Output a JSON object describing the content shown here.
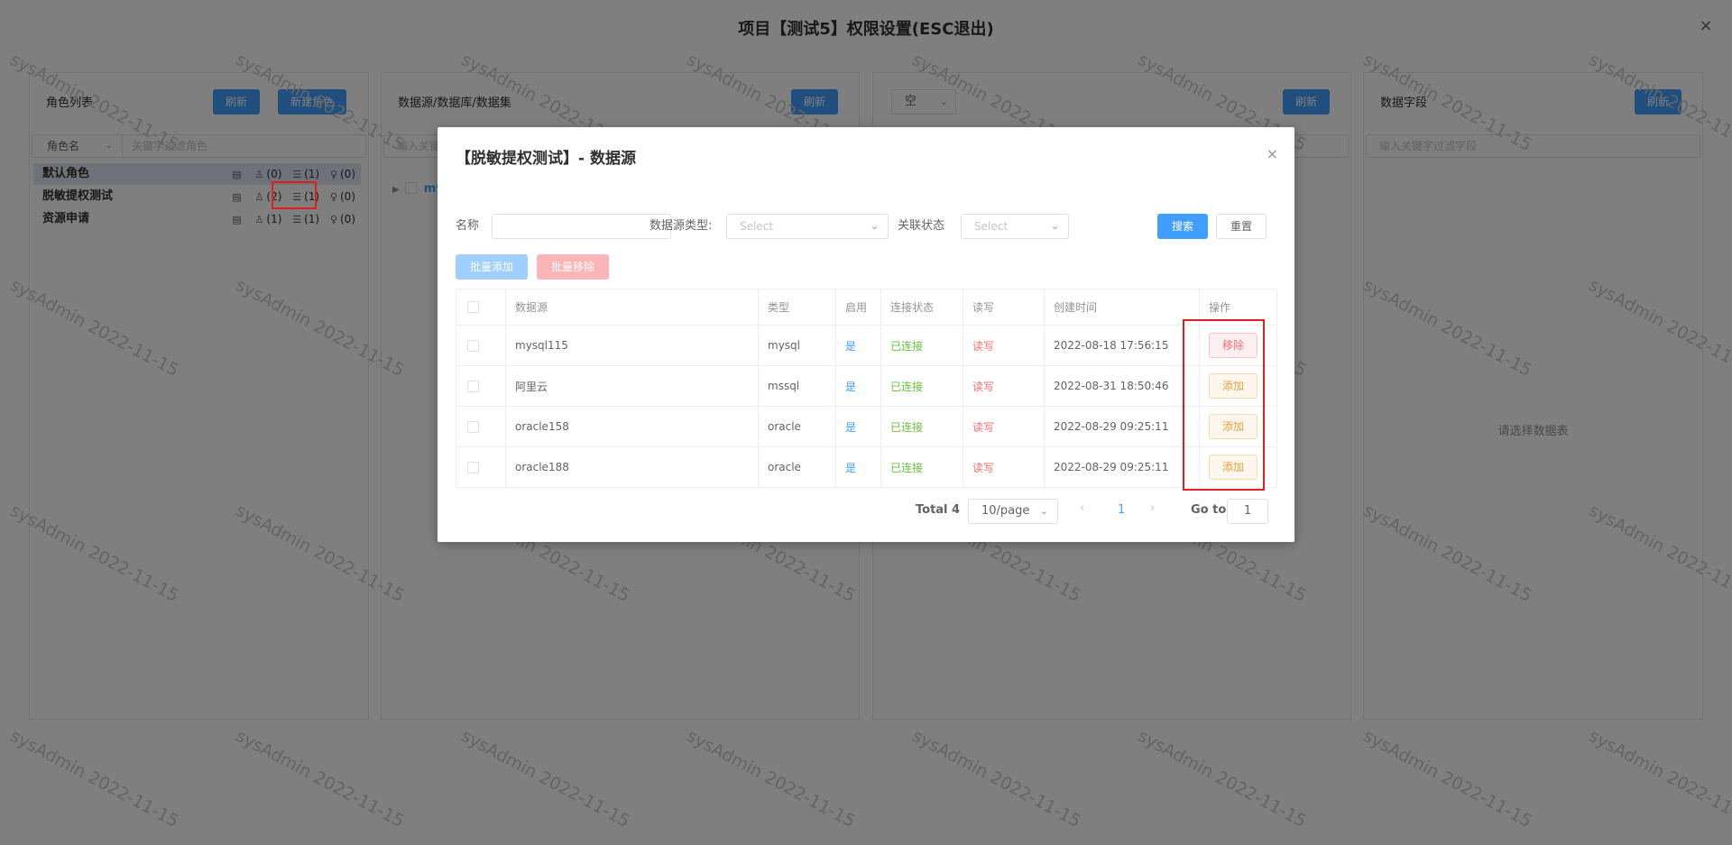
{
  "page": {
    "title": "项目【测试5】权限设置(ESC退出)",
    "close_icon": "×"
  },
  "role_panel": {
    "title": "角色列表",
    "refresh_label": "刷新",
    "new_role_label": "新建角色",
    "filter_select": "角色名",
    "filter_placeholder": "关键字过滤角色",
    "roles": [
      {
        "name": "默认角色",
        "users": "(0)",
        "datasets": "(1)",
        "rules": "(0)"
      },
      {
        "name": "脱敏提权测试",
        "users": "(2)",
        "datasets": "(1)",
        "rules": "(0)"
      },
      {
        "name": "资源申请",
        "users": "(1)",
        "datasets": "(1)",
        "rules": "(0)"
      }
    ]
  },
  "ds_panel": {
    "title": "数据源/数据库/数据集",
    "refresh_label": "刷新",
    "filter_placeholder": "输入关键",
    "tree_item": "my"
  },
  "table_panel": {
    "select_value": "空",
    "refresh_label": "刷新"
  },
  "field_panel": {
    "title": "数据字段",
    "refresh_label": "刷新",
    "filter_placeholder": "输入关键字过滤字段",
    "empty_text": "请选择数据表"
  },
  "watermark": "sysAdmin 2022-11-15",
  "modal": {
    "title": "【脱敏提权测试】- 数据源",
    "close_icon": "×",
    "name_label": "名称",
    "type_label": "数据源类型:",
    "type_placeholder": "Select",
    "status_label": "关联状态",
    "status_placeholder": "Select",
    "search_label": "搜索",
    "reset_label": "重置",
    "batch_add_label": "批量添加",
    "batch_remove_label": "批量移除",
    "columns": [
      "数据源",
      "类型",
      "启用",
      "连接状态",
      "读写",
      "创建时间",
      "操作"
    ],
    "rows": [
      {
        "name": "mysql115",
        "type": "mysql",
        "enabled": "是",
        "conn": "已连接",
        "rw": "读写",
        "created": "2022-08-18 17:56:15",
        "action": "移除"
      },
      {
        "name": "阿里云",
        "type": "mssql",
        "enabled": "是",
        "conn": "已连接",
        "rw": "读写",
        "created": "2022-08-31 18:50:46",
        "action": "添加"
      },
      {
        "name": "oracle158",
        "type": "oracle",
        "enabled": "是",
        "conn": "已连接",
        "rw": "读写",
        "created": "2022-08-29 09:25:11",
        "action": "添加"
      },
      {
        "name": "oracle188",
        "type": "oracle",
        "enabled": "是",
        "conn": "已连接",
        "rw": "读写",
        "created": "2022-08-29 09:25:11",
        "action": "添加"
      }
    ],
    "pagination": {
      "total": "Total 4",
      "page_size": "10/page",
      "current_page": "1",
      "goto_label": "Go to",
      "goto_value": "1"
    }
  }
}
